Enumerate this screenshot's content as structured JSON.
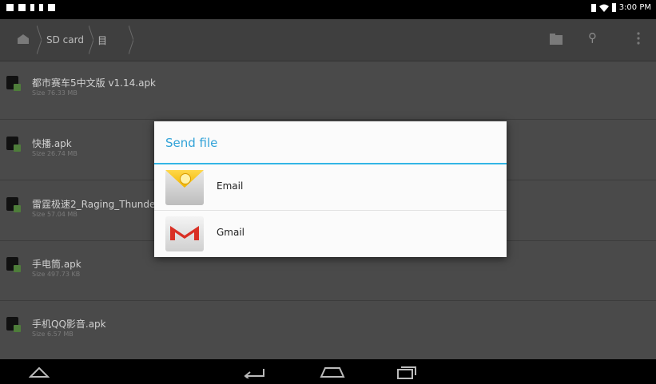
{
  "status_bar": {
    "time": "3:00 PM"
  },
  "action_bar": {
    "breadcrumbs": [
      "SD card",
      "目"
    ]
  },
  "files": [
    {
      "name": "都市赛车5中文版 v1.14.apk",
      "size": "Size 76.33 MB"
    },
    {
      "name": "快播.apk",
      "size": "Size 26.74 MB"
    },
    {
      "name": "雷霆极速2_Raging_Thunder...",
      "size": "Size 57.04 MB"
    },
    {
      "name": "手电筒.apk",
      "size": "Size 497.73 KB"
    },
    {
      "name": "手机QQ影音.apk",
      "size": "Size 6.57 MB"
    }
  ],
  "dialog": {
    "title": "Send file",
    "options": [
      {
        "label": "Email",
        "icon": "email-app-icon"
      },
      {
        "label": "Gmail",
        "icon": "gmail-app-icon"
      }
    ]
  },
  "colors": {
    "accent": "#33b5e5",
    "dim_background": "#4a4a4a"
  }
}
